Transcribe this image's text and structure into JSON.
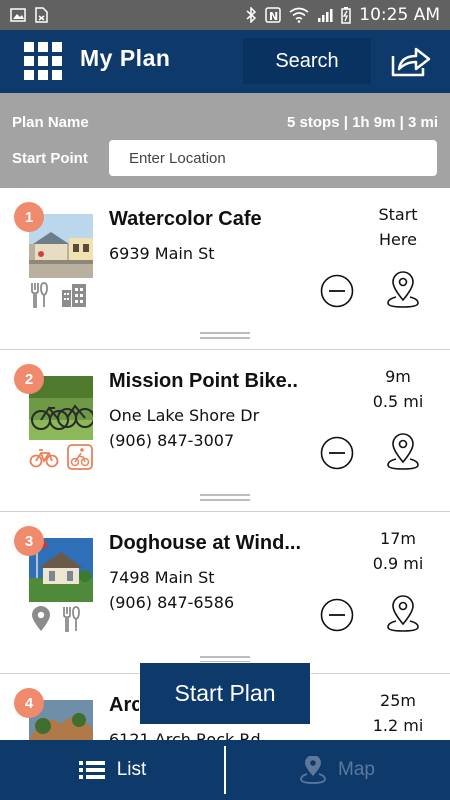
{
  "status_bar": {
    "time": "10:25 AM",
    "icons": [
      "gallery-icon",
      "sim-icon",
      "bluetooth-icon",
      "nfc-icon",
      "wifi-icon",
      "signal-icon",
      "battery-icon"
    ]
  },
  "header": {
    "title": "My Plan",
    "search_label": "Search",
    "icons": [
      "grid-menu-icon",
      "share-icon"
    ]
  },
  "plan": {
    "name_label": "Plan Name",
    "summary": "5 stops | 1h 9m | 3 mi",
    "start_point_label": "Start Point",
    "location_placeholder": "Enter Location"
  },
  "stops": [
    {
      "number": "1",
      "name": "Watercolor Cafe",
      "address": "6939 Main St",
      "phone": "",
      "time_line1": "Start",
      "time_line2": "Here",
      "categories": [
        "dining-icon",
        "buildings-icon"
      ]
    },
    {
      "number": "2",
      "name": "Mission Point Bike..",
      "address": "One Lake Shore Dr",
      "phone": "(906) 847-3007",
      "time_line1": "9m",
      "time_line2": "0.5 mi",
      "categories": [
        "bicycle-icon",
        "cyclist-icon"
      ]
    },
    {
      "number": "3",
      "name": "Doghouse at Wind...",
      "address": "7498 Main St",
      "phone": "(906) 847-6586",
      "time_line1": "17m",
      "time_line2": "0.9 mi",
      "categories": [
        "map-pin-icon",
        "dining-icon"
      ]
    },
    {
      "number": "4",
      "name": "Arc",
      "address": "6121 Arch Rock Rd",
      "phone": "",
      "time_line1": "25m",
      "time_line2": "1.2 mi",
      "categories": []
    }
  ],
  "start_plan_label": "Start Plan",
  "nav": {
    "list_label": "List",
    "map_label": "Map"
  },
  "colors": {
    "header_navy": "#0e3a6b",
    "plan_bar_gray": "#a3a3a3",
    "stop_badge": "#ef8a6c",
    "category_orange": "#e8825a",
    "category_gray": "#8c8c8c"
  }
}
